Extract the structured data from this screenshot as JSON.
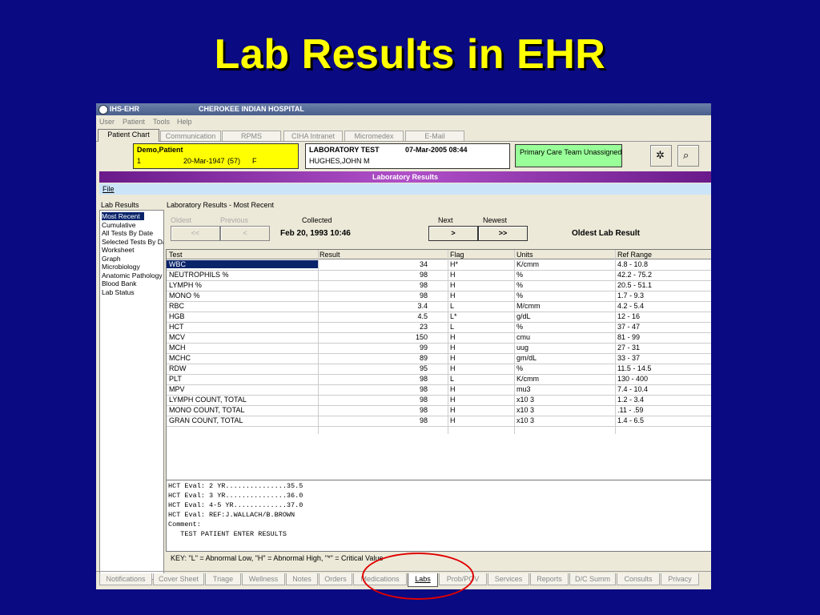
{
  "slide": {
    "title": "Lab Results in EHR"
  },
  "window": {
    "app_name": "IHS-EHR",
    "hospital": "CHEROKEE INDIAN HOSPITAL"
  },
  "menu": [
    "User",
    "Patient",
    "Tools",
    "Help"
  ],
  "top_tabs": [
    "Patient Chart",
    "Communication",
    "RPMS",
    "CIHA Intranet",
    "Micromedex",
    "E-Mail"
  ],
  "patient": {
    "name": "Demo,Patient",
    "id": "1",
    "dob": "20-Mar-1947",
    "age": "(57)",
    "sex": "F"
  },
  "lab_box": {
    "title": "LABORATORY TEST",
    "datetime": "07-Mar-2005 08:44",
    "provider": "HUGHES,JOHN M"
  },
  "team_box": {
    "text": "Primary Care Team Unassigned"
  },
  "section_title": "Laboratory Results",
  "file_menu": "File",
  "lab_results_label": "Lab Results",
  "left_list": [
    "Most Recent",
    "Cumulative",
    "All Tests By Date",
    "Selected Tests By Date",
    "Worksheet",
    "Graph",
    "Microbiology",
    "Anatomic Pathology",
    "Blood Bank",
    "Lab Status"
  ],
  "main_label": "Laboratory Results - Most Recent",
  "nav": {
    "oldest": "Oldest",
    "previous": "Previous",
    "collected": "Collected",
    "next": "Next",
    "newest": "Newest",
    "btn_oldest": "<<",
    "btn_previous": "<",
    "btn_next": ">",
    "btn_newest": ">>",
    "collected_value": "Feb 20, 1993 10:46",
    "oldest_result": "Oldest Lab Result"
  },
  "grid": {
    "headers": [
      "Test",
      "Result",
      "Flag",
      "Units",
      "Ref Range"
    ],
    "rows": [
      [
        "WBC",
        "34",
        "H*",
        "K/cmm",
        "4.8 - 10.8"
      ],
      [
        "NEUTROPHILS %",
        "98",
        "H",
        "%",
        "42.2 - 75.2"
      ],
      [
        "LYMPH %",
        "98",
        "H",
        "%",
        "20.5 - 51.1"
      ],
      [
        "MONO %",
        "98",
        "H",
        "%",
        "1.7 - 9.3"
      ],
      [
        "RBC",
        "3.4",
        "L",
        "M/cmm",
        "4.2 - 5.4"
      ],
      [
        "HGB",
        "4.5",
        "L*",
        "g/dL",
        "12 - 16"
      ],
      [
        "HCT",
        "23",
        "L",
        "%",
        "37 - 47"
      ],
      [
        "MCV",
        "150",
        "H",
        "cmu",
        "81 - 99"
      ],
      [
        "MCH",
        "99",
        "H",
        "uug",
        "27 - 31"
      ],
      [
        "MCHC",
        "89",
        "H",
        "gm/dL",
        "33 - 37"
      ],
      [
        "RDW",
        "95",
        "H",
        "%",
        "11.5 - 14.5"
      ],
      [
        "PLT",
        "98",
        "L",
        "K/cmm",
        "130 - 400"
      ],
      [
        "MPV",
        "98",
        "H",
        "mu3",
        "7.4 - 10.4"
      ],
      [
        "LYMPH COUNT, TOTAL",
        "98",
        "H",
        "x10 3",
        "1.2 - 3.4"
      ],
      [
        "MONO COUNT, TOTAL",
        "98",
        "H",
        "x10 3",
        ".11 - .59"
      ],
      [
        "GRAN COUNT, TOTAL",
        "98",
        "H",
        "x10 3",
        "1.4 - 6.5"
      ]
    ]
  },
  "notes": [
    "HCT Eval: 2 YR...............35.5",
    "HCT Eval: 3 YR...............36.0",
    "HCT Eval: 4-5 YR.............37.0",
    "HCT Eval: REF:J.WALLACH/B.BROWN",
    "Comment:",
    "   TEST PATIENT ENTER RESULTS"
  ],
  "key": "KEY: \"L\" = Abnormal Low, \"H\" = Abnormal High, \"*\" = Critical Value",
  "bottom_tabs": [
    "Notifications",
    "Cover Sheet",
    "Triage",
    "Wellness",
    "Notes",
    "Orders",
    "Medications",
    "Labs",
    "Prob/POV",
    "Services",
    "Reports",
    "D/C Summ",
    "Consults",
    "Privacy"
  ],
  "active_bottom_tab": "Labs",
  "colors": {
    "background": "#0a0a82",
    "title": "#ffff00",
    "patient_box": "#ffff00",
    "team_box": "#99ff99",
    "highlight_circle": "#e00000"
  }
}
